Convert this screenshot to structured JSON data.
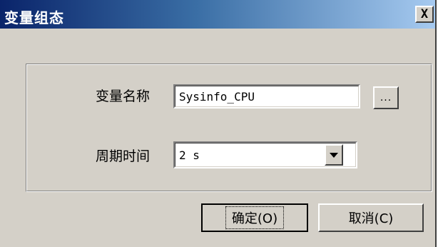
{
  "dialog": {
    "title": "变量组态",
    "close_label": "X"
  },
  "form": {
    "var_name_label": "变量名称",
    "var_name_value": "Sysinfo_CPU",
    "browse_label": "...",
    "period_label": "周期时间",
    "period_value": "2 s"
  },
  "buttons": {
    "ok_label": "确定(O)",
    "cancel_label": "取消(C)"
  }
}
